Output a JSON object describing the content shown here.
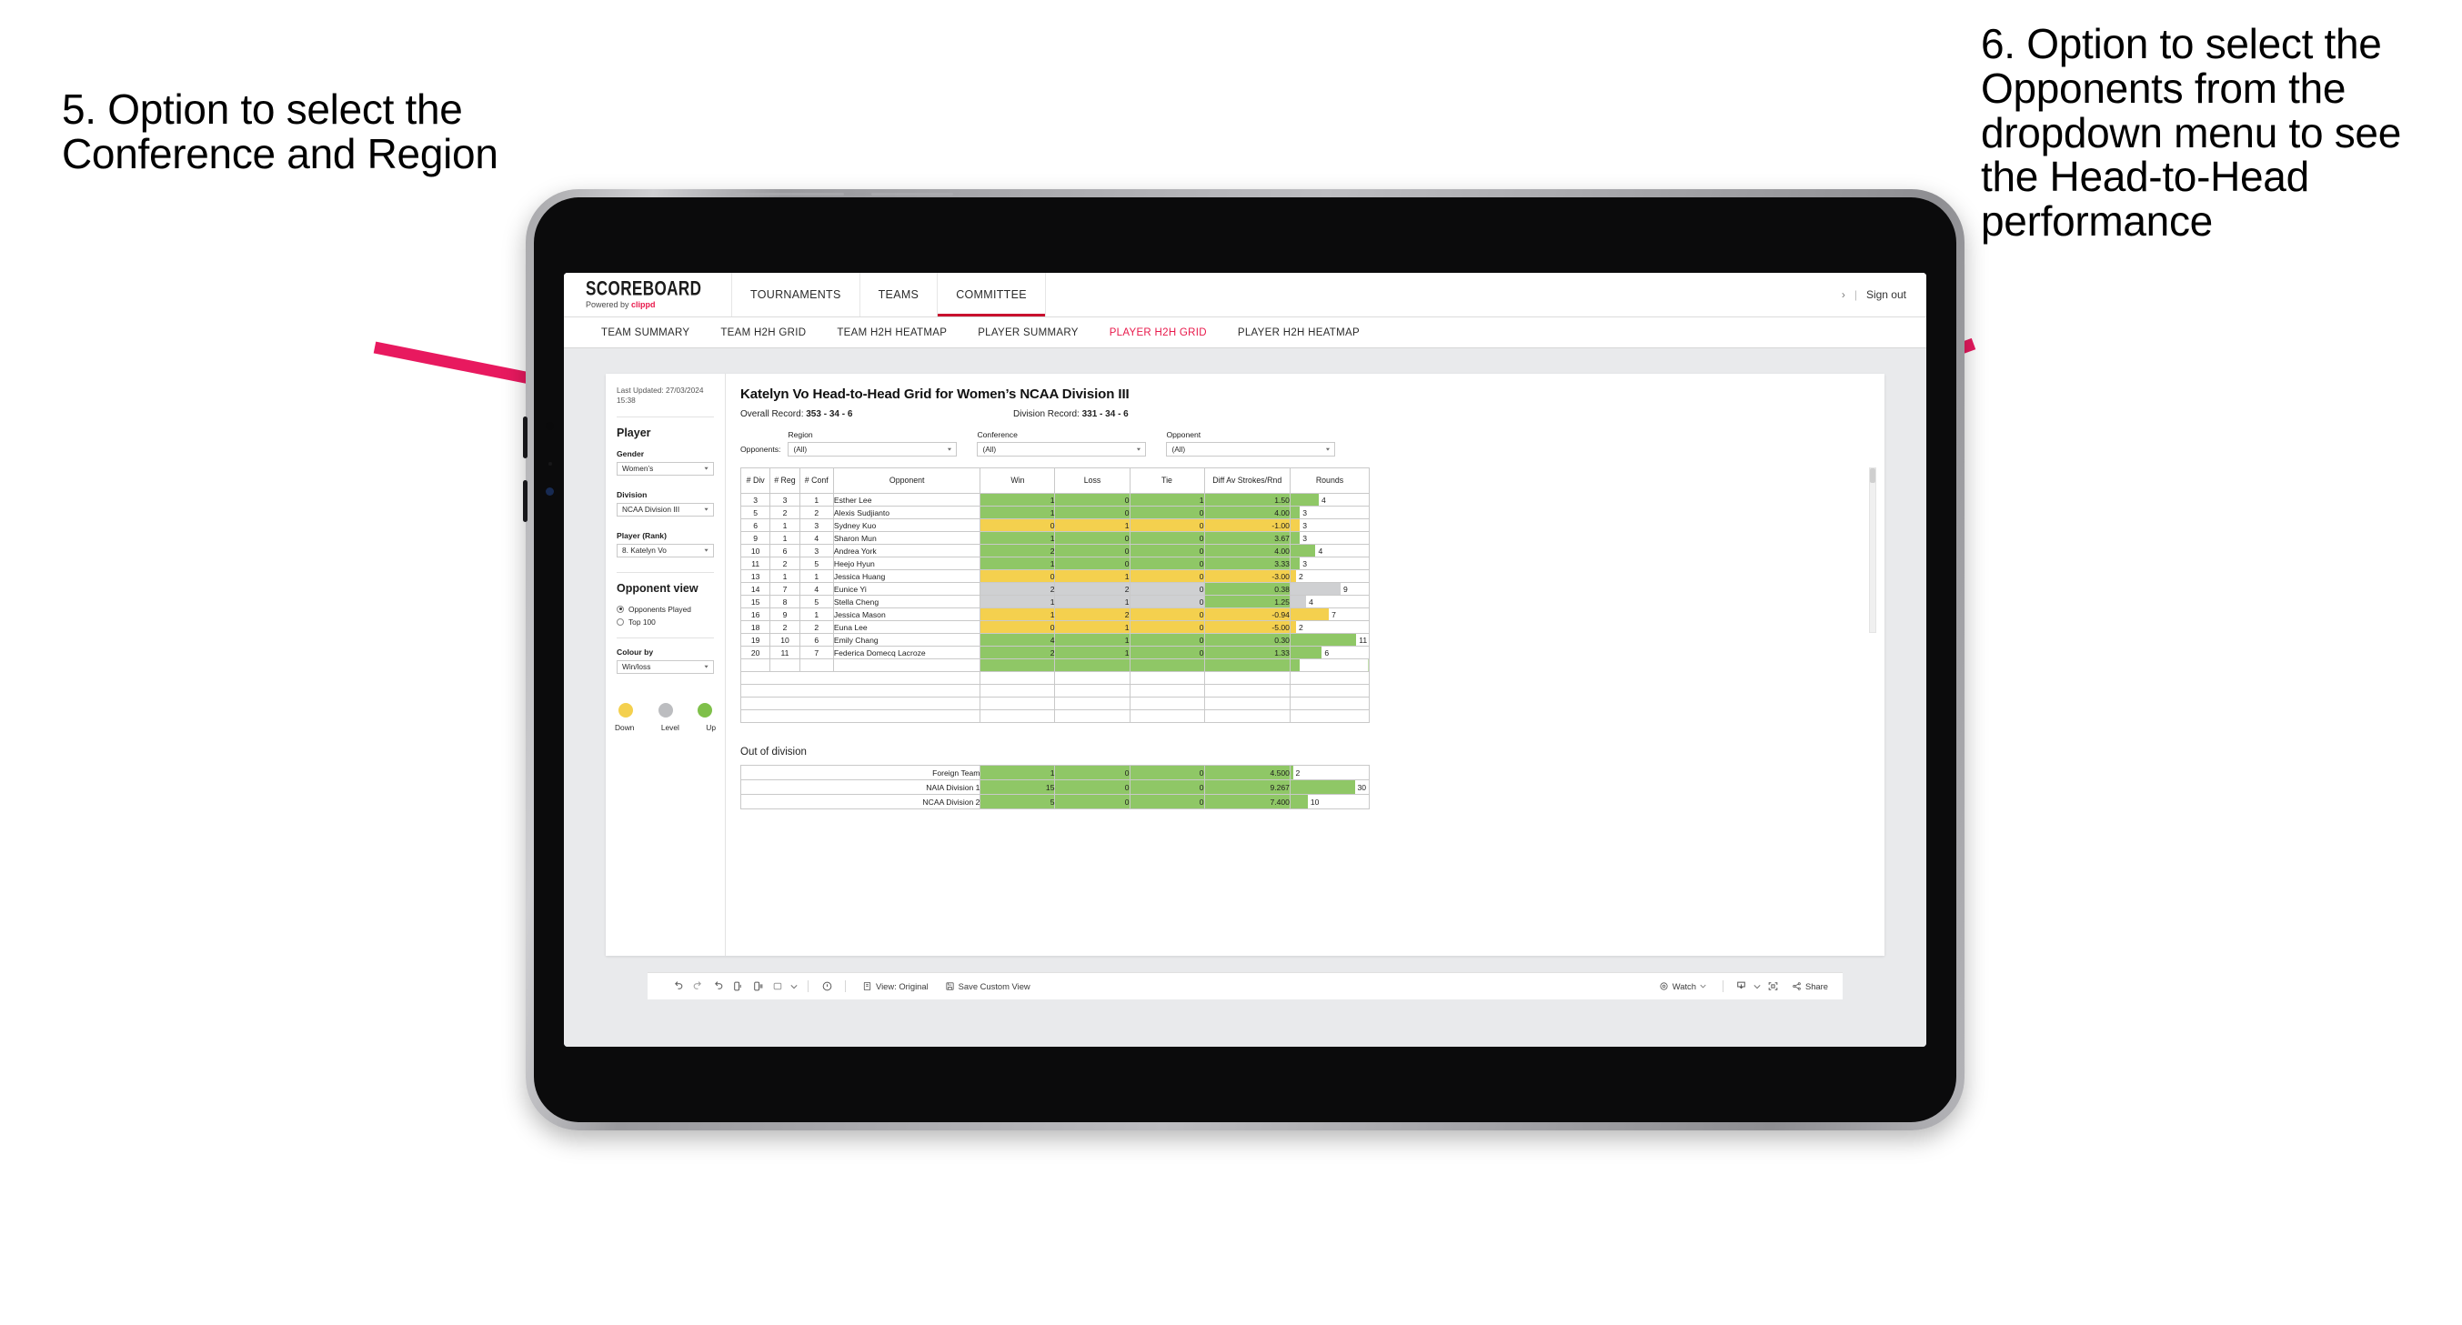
{
  "annotations": {
    "left": "5. Option to select the Conference and Region",
    "right": "6. Option to select the Opponents from the dropdown menu to see the Head-to-Head performance",
    "arrow_color": "#e8195f"
  },
  "app": {
    "brand": {
      "title": "SCOREBOARD",
      "powered_prefix": "Powered by ",
      "powered_brand": "clippd"
    },
    "nav": [
      {
        "label": "TOURNAMENTS",
        "active": false
      },
      {
        "label": "TEAMS",
        "active": false
      },
      {
        "label": "COMMITTEE",
        "active": true
      }
    ],
    "topbar_right": {
      "chevron": "›",
      "separator": "|",
      "signout": "Sign out"
    },
    "subnav": [
      {
        "label": "TEAM SUMMARY",
        "active": false
      },
      {
        "label": "TEAM H2H GRID",
        "active": false
      },
      {
        "label": "TEAM H2H HEATMAP",
        "active": false
      },
      {
        "label": "PLAYER SUMMARY",
        "active": false
      },
      {
        "label": "PLAYER H2H GRID",
        "active": true
      },
      {
        "label": "PLAYER H2H HEATMAP",
        "active": false
      }
    ],
    "accent": "#e8194b"
  },
  "sidebar": {
    "last_updated": "Last Updated: 27/03/2024 15:38",
    "player_heading": "Player",
    "gender": {
      "label": "Gender",
      "value": "Women’s"
    },
    "division": {
      "label": "Division",
      "value": "NCAA Division III"
    },
    "player_rank": {
      "label": "Player (Rank)",
      "value": "8. Katelyn Vo"
    },
    "opponent_view": {
      "heading": "Opponent view",
      "options": [
        {
          "label": "Opponents Played",
          "selected": true
        },
        {
          "label": "Top 100",
          "selected": false
        }
      ]
    },
    "colour_by": {
      "label": "Colour by",
      "value": "Win/loss"
    },
    "legend": [
      {
        "label": "Down",
        "color": "#f4d04e"
      },
      {
        "label": "Level",
        "color": "#bcbdc0"
      },
      {
        "label": "Up",
        "color": "#7fc04a"
      }
    ]
  },
  "main": {
    "title": "Katelyn Vo Head-to-Head Grid for Women’s NCAA Division III",
    "overall_record_label": "Overall Record: ",
    "overall_record_value": "353 - 34 - 6",
    "division_record_label": "Division Record: ",
    "division_record_value": "331 - 34 - 6",
    "filters_label": "Opponents:",
    "filters": [
      {
        "title": "Region",
        "value": "(All)"
      },
      {
        "title": "Conference",
        "value": "(All)"
      },
      {
        "title": "Opponent",
        "value": "(All)"
      }
    ],
    "columns": [
      "# Div",
      "# Reg",
      "# Conf",
      "Opponent",
      "Win",
      "Loss",
      "Tie",
      "Diff Av Strokes/Rnd",
      "Rounds"
    ],
    "rows": [
      {
        "div": "3",
        "reg": "3",
        "conf": "1",
        "opponent": "Esther Lee",
        "win": "1",
        "loss": "0",
        "tie": "1",
        "diff": "1.50",
        "rounds": "4",
        "color": "#8fc766",
        "barpct": 36
      },
      {
        "div": "5",
        "reg": "2",
        "conf": "2",
        "opponent": "Alexis Sudjianto",
        "win": "1",
        "loss": "0",
        "tie": "0",
        "diff": "4.00",
        "rounds": "3",
        "color": "#8fc766",
        "barpct": 12
      },
      {
        "div": "6",
        "reg": "1",
        "conf": "3",
        "opponent": "Sydney Kuo",
        "win": "0",
        "loss": "1",
        "tie": "0",
        "diff": "-1.00",
        "rounds": "3",
        "color": "#f4d04e",
        "barpct": 12
      },
      {
        "div": "9",
        "reg": "1",
        "conf": "4",
        "opponent": "Sharon Mun",
        "win": "1",
        "loss": "0",
        "tie": "0",
        "diff": "3.67",
        "rounds": "3",
        "color": "#8fc766",
        "barpct": 12
      },
      {
        "div": "10",
        "reg": "6",
        "conf": "3",
        "opponent": "Andrea York",
        "win": "2",
        "loss": "0",
        "tie": "0",
        "diff": "4.00",
        "rounds": "4",
        "color": "#8fc766",
        "barpct": 32
      },
      {
        "div": "11",
        "reg": "2",
        "conf": "5",
        "opponent": "Heejo Hyun",
        "win": "1",
        "loss": "0",
        "tie": "0",
        "diff": "3.33",
        "rounds": "3",
        "color": "#8fc766",
        "barpct": 12
      },
      {
        "div": "13",
        "reg": "1",
        "conf": "1",
        "opponent": "Jessica Huang",
        "win": "0",
        "loss": "1",
        "tie": "0",
        "diff": "-3.00",
        "rounds": "2",
        "color": "#f4d04e",
        "barpct": 7
      },
      {
        "div": "14",
        "reg": "7",
        "conf": "4",
        "opponent": "Eunice Yi",
        "win": "2",
        "loss": "2",
        "tie": "0",
        "diff": "0.38",
        "rounds": "9",
        "color": "#cfd0d2",
        "barpct": 64,
        "diff_color": "#8fc766"
      },
      {
        "div": "15",
        "reg": "8",
        "conf": "5",
        "opponent": "Stella Cheng",
        "win": "1",
        "loss": "1",
        "tie": "0",
        "diff": "1.25",
        "rounds": "4",
        "color": "#cfd0d2",
        "barpct": 20,
        "diff_color": "#8fc766"
      },
      {
        "div": "16",
        "reg": "9",
        "conf": "1",
        "opponent": "Jessica Mason",
        "win": "1",
        "loss": "2",
        "tie": "0",
        "diff": "-0.94",
        "rounds": "7",
        "color": "#f4d04e",
        "barpct": 49
      },
      {
        "div": "18",
        "reg": "2",
        "conf": "2",
        "opponent": "Euna Lee",
        "win": "0",
        "loss": "1",
        "tie": "0",
        "diff": "-5.00",
        "rounds": "2",
        "color": "#f4d04e",
        "barpct": 7
      },
      {
        "div": "19",
        "reg": "10",
        "conf": "6",
        "opponent": "Emily Chang",
        "win": "4",
        "loss": "1",
        "tie": "0",
        "diff": "0.30",
        "rounds": "11",
        "color": "#8fc766",
        "barpct": 84
      },
      {
        "div": "20",
        "reg": "11",
        "conf": "7",
        "opponent": "Federica Domecq Lacroze",
        "win": "2",
        "loss": "1",
        "tie": "0",
        "diff": "1.33",
        "rounds": "6",
        "color": "#8fc766",
        "barpct": 40
      }
    ],
    "out_of_division": {
      "title": "Out of division",
      "rows": [
        {
          "name": "Foreign Team",
          "win": "1",
          "loss": "0",
          "tie": "0",
          "diff": "4.500",
          "rounds": "2",
          "color": "#8fc766",
          "barpct": 3
        },
        {
          "name": "NAIA Division 1",
          "win": "15",
          "loss": "0",
          "tie": "0",
          "diff": "9.267",
          "rounds": "30",
          "color": "#8fc766",
          "barpct": 82
        },
        {
          "name": "NCAA Division 2",
          "win": "5",
          "loss": "0",
          "tie": "0",
          "diff": "7.400",
          "rounds": "10",
          "color": "#8fc766",
          "barpct": 22
        }
      ]
    }
  },
  "toolbar": {
    "view_label": "View: Original",
    "save_label": "Save Custom View",
    "watch_label": "Watch",
    "share_label": "Share"
  }
}
